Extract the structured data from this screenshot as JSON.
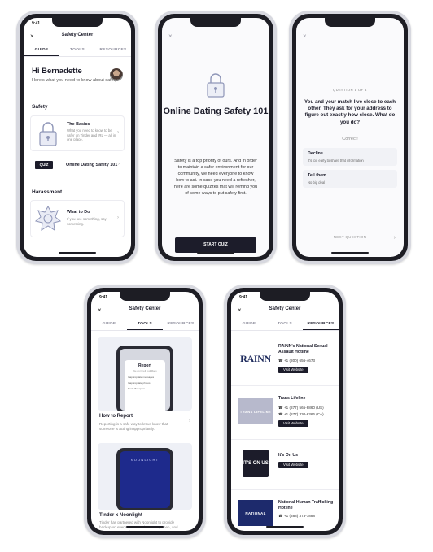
{
  "phone1": {
    "time": "9:41",
    "close": "×",
    "title": "Safety Center",
    "tabs": [
      "GUIDE",
      "TOOLS",
      "RESOURCES"
    ],
    "greeting": "Hi Bernadette",
    "subgreeting": "Here's what you need to know about safety.",
    "section_safety": "Safety",
    "basics_title": "The Basics",
    "basics_desc": "What you need to know to be safer on Tinder and IRL — all in one place.",
    "quiz_chip": "QUIZ",
    "quiz_title": "Online Dating Safety 101",
    "section_harassment": "Harassment",
    "wtd_title": "What to Do",
    "wtd_desc": "If you see something, say something."
  },
  "phone2": {
    "close": "×",
    "title": "Online Dating Safety 101",
    "body": "Safety is a top priority of ours. And in order to maintain a safer environment for our community, we need everyone to know how to act. In case you need a refresher, here are some quizzes that will remind you of some ways to put safety first.",
    "button": "START QUIZ"
  },
  "phone3": {
    "close": "×",
    "qnum": "QUESTION 1 OF 4",
    "question": "You and your match live close to each other. They ask for your address to figure out exactly how close. What do you do?",
    "correct": "Correct!",
    "options": [
      {
        "title": "Decline",
        "desc": "It's too early to share that information"
      },
      {
        "title": "Tell them",
        "desc": "No big deal"
      }
    ],
    "next": "NEXT QUESTION",
    "next_icon": "›"
  },
  "phone4": {
    "time": "9:41",
    "close": "×",
    "title": "Safety Center",
    "tabs": [
      "GUIDE",
      "TOOLS",
      "RESOURCES"
    ],
    "report_screen_title": "Report",
    "report_screen_sub": "We won't tell Judi/Mads",
    "report_items": [
      "Inappropriate messages",
      "Inappropriate photos",
      "Feels like spam"
    ],
    "report_title": "How to Report",
    "report_desc": "Reporting is a safe way to let us know that someone is acting inappropriately.",
    "noonlight_logo": "NOONLIGHT",
    "noonlight_title": "Tinder x Noonlight",
    "noonlight_desc": "Tinder has partnered with Noonlight to provide backup on every meetup. Share who, when, and where you're meeting."
  },
  "phone5": {
    "time": "9:41",
    "close": "×",
    "title": "Safety Center",
    "tabs": [
      "GUIDE",
      "TOOLS",
      "RESOURCES"
    ],
    "resources": [
      {
        "logo": "RAINN",
        "name": "RAINN's National Sexual Assault Hotline",
        "phones": [
          "+1 (800) 656-4673"
        ],
        "button": "Visit Website"
      },
      {
        "logo": "TRANS LIFELINE",
        "name": "Trans Lifeline",
        "phones": [
          "+1 (877) 565-8860 (US)",
          "+1 (877) 330-6366 (CA)"
        ],
        "button": "Visit Website"
      },
      {
        "logo": "IT'S ON US",
        "name": "It's On Us",
        "phones": [],
        "button": "Visit Website"
      },
      {
        "logo": "NATIONAL",
        "name": "National Human Trafficking Hotline",
        "phones": [
          "+1 (888) 373-7888"
        ],
        "button": ""
      }
    ]
  }
}
